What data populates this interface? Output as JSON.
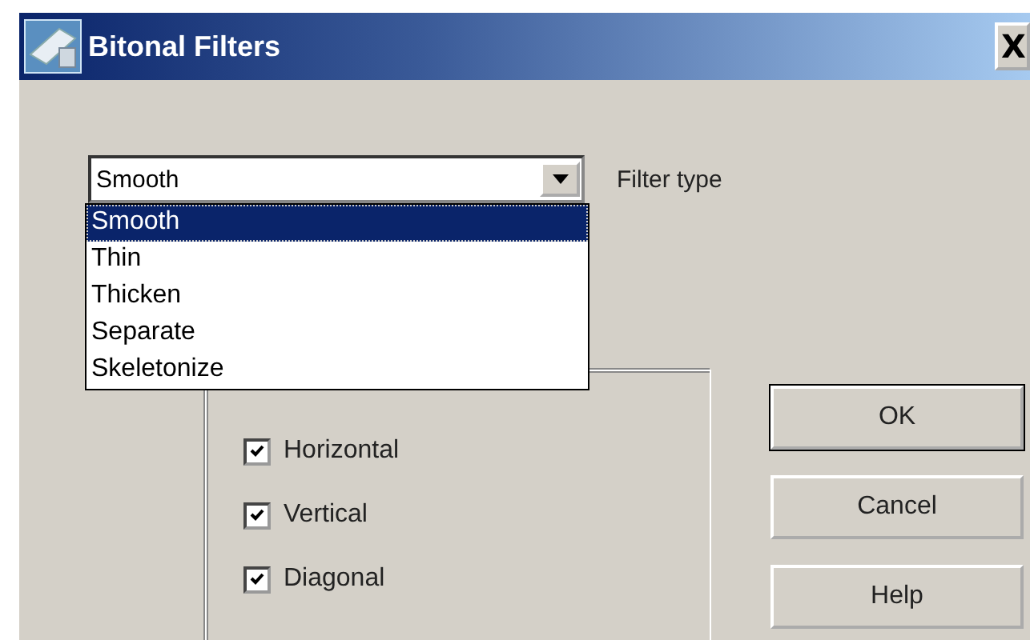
{
  "window": {
    "title": "Bitonal Filters",
    "close": "X"
  },
  "filter": {
    "value": "Smooth",
    "label": "Filter type",
    "expanded": true,
    "options": [
      {
        "label": "Smooth",
        "selected": true
      },
      {
        "label": "Thin",
        "selected": false
      },
      {
        "label": "Thicken",
        "selected": false
      },
      {
        "label": "Separate",
        "selected": false
      },
      {
        "label": "Skeletonize",
        "selected": false
      }
    ]
  },
  "directions": [
    {
      "label": "Horizontal",
      "checked": true
    },
    {
      "label": "Vertical",
      "checked": true
    },
    {
      "label": "Diagonal",
      "checked": true
    }
  ],
  "buttons": [
    {
      "label": "OK",
      "default": true
    },
    {
      "label": "Cancel",
      "default": false
    },
    {
      "label": "Help",
      "default": false
    }
  ]
}
